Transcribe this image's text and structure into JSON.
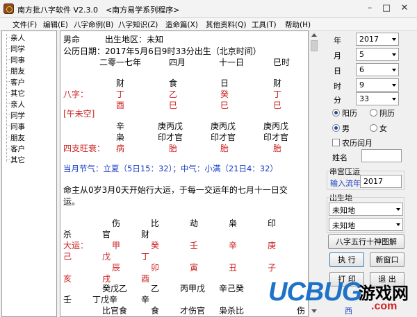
{
  "window": {
    "title": "南方批八字软件 V2.3.0　<南方易学系列程序>"
  },
  "menu": [
    "文件(F)",
    "编辑(E)",
    "八字命例(B)",
    "八字知识(Z)",
    "造命篇(X)",
    "其他资料(Q)",
    "工具(T)",
    "帮助(H)"
  ],
  "tree": [
    "亲人",
    "同学",
    "同事",
    "朋友",
    "客户",
    "其它",
    "亲人",
    "同学",
    "同事",
    "朋友",
    "客户",
    "其它"
  ],
  "chart": {
    "line1": "男命　　　出生地区：未知",
    "line2": "公历日期：2017年5月6日9时33分出生（北京时间）",
    "cal_year": "二零一七年",
    "cal_month": "四月",
    "cal_day": "十一日",
    "cal_hour": "巳时",
    "shishen": [
      "财",
      "食",
      "日",
      "财"
    ],
    "bazi_label": "八字：",
    "gan": [
      "丁",
      "乙",
      "癸",
      "丁"
    ],
    "zhi": [
      "酉",
      "巳",
      "巳",
      "巳"
    ],
    "kongwang": "[午未空]",
    "cang1": [
      "辛",
      "庚丙戊",
      "庚丙戊",
      "庚丙戊"
    ],
    "cang2": [
      "枭",
      "印才官",
      "印才官",
      "印才官"
    ],
    "wangshuai_label": "四支旺衰：",
    "wangshuai": [
      "病",
      "胎",
      "胎",
      "胎"
    ],
    "jieqi": "当月节气：立夏（5日15：32）；中气：小满（21日4：32）",
    "qiyun_1": "命主从0岁3月0天开始行大运，于每一交运年的七月十一日交",
    "qiyun_2": "运。",
    "dy_row1": [
      "伤",
      "比",
      "劫",
      "枭",
      "印"
    ],
    "dy_row2": [
      "杀",
      "官",
      "财"
    ],
    "dy_label": "大运：",
    "dy_gan": [
      "甲",
      "癸",
      "壬",
      "辛",
      "庚"
    ],
    "dy_row4": [
      "己",
      "戊",
      "丁"
    ],
    "dy_zhi": [
      "辰",
      "卯",
      "寅",
      "丑",
      "子"
    ],
    "dy_row6": [
      "亥",
      "戌",
      "酉"
    ],
    "dy_row7": [
      "癸戊乙",
      "乙",
      "丙甲戊",
      "辛己癸"
    ],
    "dy_row8": [
      "壬",
      "丁戊辛",
      "辛"
    ],
    "dy_row9": [
      "比官食",
      "食",
      "才伤官",
      "枭杀比",
      "伤"
    ]
  },
  "panel": {
    "year_label": "年",
    "year": "2017",
    "month_label": "月",
    "month": "5",
    "day_label": "日",
    "day": "6",
    "hour_label": "时",
    "hour": "9",
    "minute_label": "分",
    "minute": "33",
    "yangli": "阳历",
    "yinli": "阴历",
    "male": "男",
    "female": "女",
    "leap": "农历闰月",
    "name_label": "姓名",
    "liunian_group": "串宫压运",
    "liunian_label": "输入流年",
    "liunian_value": "2017",
    "birthplace_group": "出生地",
    "place1": "未知地",
    "place2": "未知地",
    "btn_tushi": "八字五行十神图解",
    "btn_run": "执 行",
    "btn_new": "新窗口",
    "btn_print": "打 印",
    "btn_exit": "退 出",
    "bottom_partial": "西"
  },
  "watermark": {
    "brand": "UCBUG",
    "cn": "游戏网",
    "site": ".com"
  },
  "colors": {
    "red": "#cc2222",
    "blue": "#1a3fc4",
    "watermark_blue": "#1e73c8",
    "watermark_red": "#d42020"
  }
}
